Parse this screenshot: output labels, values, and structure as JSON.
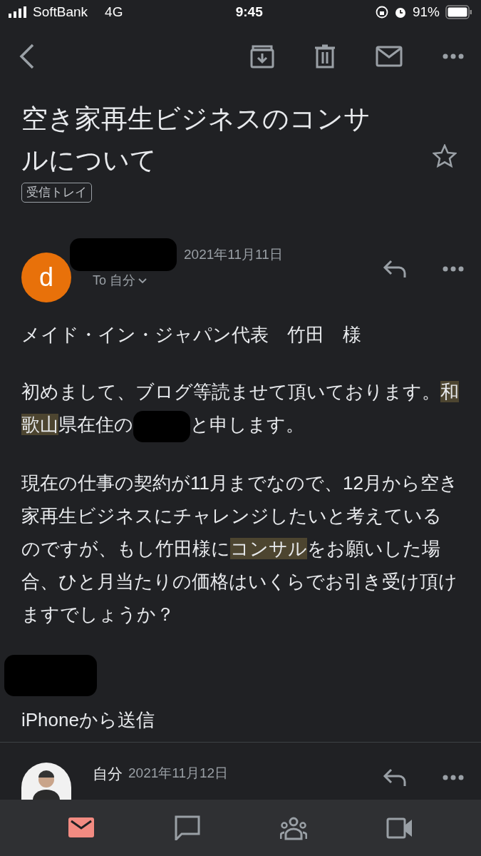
{
  "status_bar": {
    "carrier": "SoftBank",
    "network": "4G",
    "time": "9:45",
    "battery_text": "91%"
  },
  "subject": {
    "title": "空き家再生ビジネスのコンサルについて",
    "label": "受信トレイ",
    "starred": false
  },
  "messages": [
    {
      "avatar": {
        "kind": "letter",
        "letter": "d",
        "color": "#e8710a"
      },
      "sender_redacted": true,
      "date": "2021年11月11日",
      "recipient": "To 自分",
      "body": [
        {
          "kind": "text",
          "segments": [
            {
              "text": "メイド・イン・ジャパン代表　竹田　様",
              "highlight": false
            }
          ]
        },
        {
          "kind": "text",
          "segments": [
            {
              "text": "初めまして、ブログ等読ませて頂いております。",
              "highlight": false
            },
            {
              "text": "和歌山",
              "highlight": true
            },
            {
              "text": "県在住の",
              "highlight": false
            },
            {
              "kind": "redaction"
            },
            {
              "text": "と申します。",
              "highlight": false
            }
          ]
        },
        {
          "kind": "text",
          "segments": [
            {
              "text": "現在の仕事の契約が11月までなので、12月から空き家再生ビジネスにチャレンジしたいと考えているのですが、もし竹田様に",
              "highlight": false
            },
            {
              "text": "コンサル",
              "highlight": true
            },
            {
              "text": "をお願いした場合、ひと月当たりの価格はいくらでお引き受け頂けますでしょうか？",
              "highlight": false
            }
          ]
        },
        {
          "kind": "redaction"
        },
        {
          "kind": "text",
          "segments": [
            {
              "text": "iPhoneから送信",
              "highlight": false
            }
          ]
        }
      ]
    },
    {
      "avatar": {
        "kind": "photo"
      },
      "sender": "自分",
      "sender_redacted": false,
      "date": "2021年11月12日"
    }
  ],
  "bottom_nav": [
    {
      "kind": "mail",
      "selected": true
    },
    {
      "kind": "chat",
      "selected": false
    },
    {
      "kind": "spaces",
      "selected": false
    },
    {
      "kind": "meet",
      "selected": false
    }
  ]
}
